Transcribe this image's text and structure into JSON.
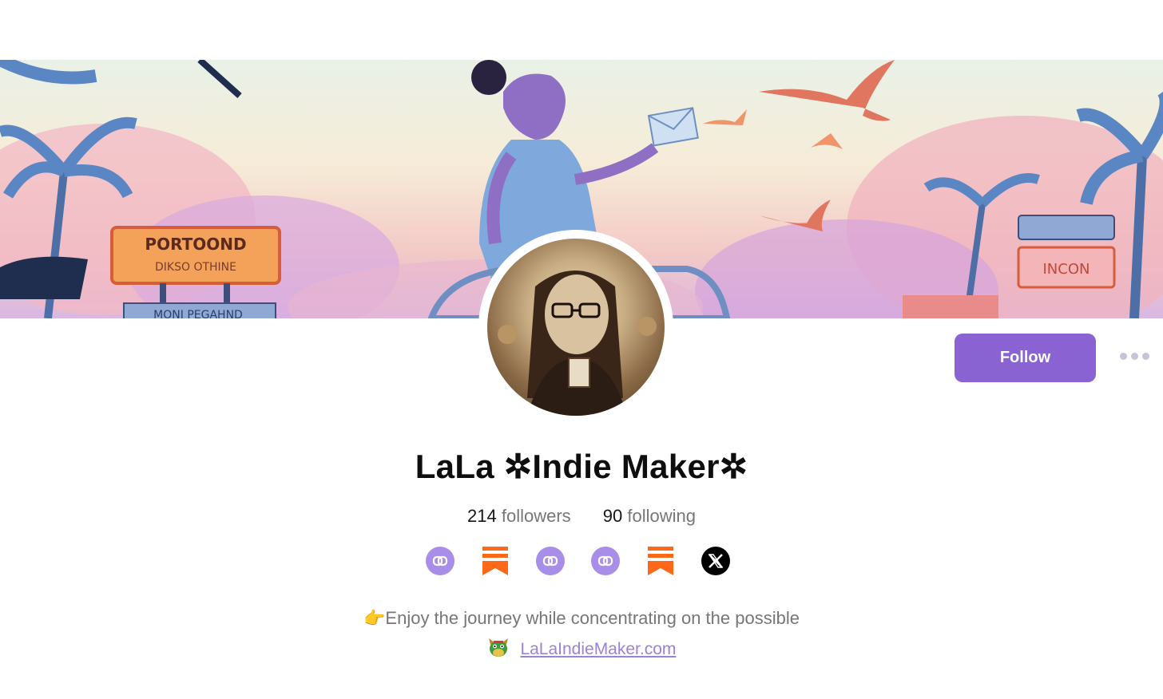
{
  "profile": {
    "name": "LaLa ✲Indie Maker✲",
    "followers_count": "214",
    "followers_label": "followers",
    "following_count": "90",
    "following_label": "following",
    "bio_line": "👉Enjoy the journey while concentrating on the possible",
    "website_label": "LaLaIndieMaker.com"
  },
  "actions": {
    "follow_label": "Follow"
  },
  "banner": {
    "sign_left_top": "PORTOOND",
    "sign_left_mid": "DIKSO OTHINE",
    "sign_left_bottom": "MONI PEGAHND",
    "sign_right": "INCON"
  },
  "socials": [
    {
      "icon": "notes-link-icon"
    },
    {
      "icon": "substack-icon"
    },
    {
      "icon": "notes-link-icon"
    },
    {
      "icon": "notes-link-icon"
    },
    {
      "icon": "substack-icon"
    },
    {
      "icon": "x-twitter-icon"
    }
  ],
  "colors": {
    "accent": "#8a63d2",
    "link": "#9b82d6",
    "substack": "#ff6719"
  }
}
